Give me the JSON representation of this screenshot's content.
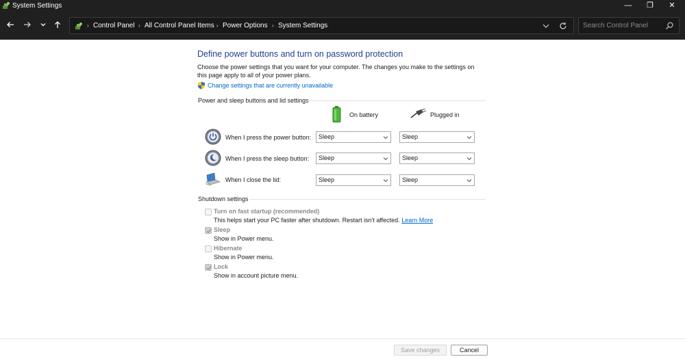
{
  "window": {
    "title": "System Settings",
    "controls": {
      "minimize": "—",
      "maximize": "❐",
      "close": "✕"
    }
  },
  "nav": {
    "breadcrumbs": [
      "Control Panel",
      "All Control Panel Items",
      "Power Options",
      "System Settings"
    ],
    "separator": "›",
    "search_placeholder": "Search Control Panel"
  },
  "main": {
    "title": "Define power buttons and turn on password protection",
    "description": "Choose the power settings that you want for your computer. The changes you make to the settings on this page apply to all of your power plans.",
    "change_link": "Change settings that are currently unavailable",
    "power_section": {
      "header": "Power and sleep buttons and lid settings",
      "columns": [
        "On battery",
        "Plugged in"
      ],
      "rows": [
        {
          "label": "When I press the power button:",
          "icon": "power-button-icon",
          "battery": "Sleep",
          "plugged": "Sleep"
        },
        {
          "label": "When I press the sleep button:",
          "icon": "sleep-button-icon",
          "battery": "Sleep",
          "plugged": "Sleep"
        },
        {
          "label": "When I close the lid:",
          "icon": "laptop-lid-icon",
          "battery": "Sleep",
          "plugged": "Sleep"
        }
      ]
    },
    "shutdown_section": {
      "header": "Shutdown settings",
      "options": [
        {
          "title": "Turn on fast startup (recommended)",
          "desc": "This helps start your PC faster after shutdown. Restart isn't affected.",
          "link": "Learn More",
          "checked": false
        },
        {
          "title": "Sleep",
          "desc": "Show in Power menu.",
          "checked": true
        },
        {
          "title": "Hibernate",
          "desc": "Show in Power menu.",
          "checked": false
        },
        {
          "title": "Lock",
          "desc": "Show in account picture menu.",
          "checked": true
        }
      ]
    }
  },
  "footer": {
    "save": "Save changes",
    "cancel": "Cancel"
  },
  "colors": {
    "title_blue": "#1e3e92",
    "link_blue": "#0066cc",
    "chrome_dark": "#202020"
  }
}
